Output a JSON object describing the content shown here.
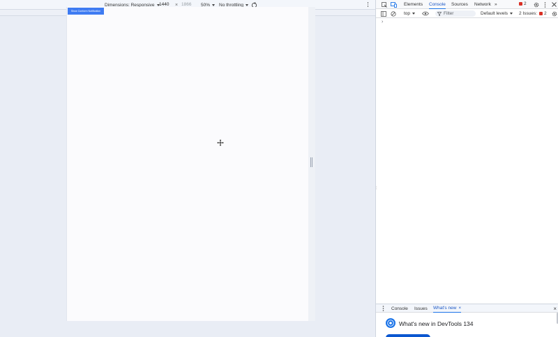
{
  "device_toolbar": {
    "dimensions_label": "Dimensions: Responsive",
    "width_value": "1440",
    "height_placeholder": "1866",
    "times_sign": "×",
    "zoom_label": "50%",
    "throttling_label": "No throttling"
  },
  "page": {
    "button_label": "Show Conform Notification"
  },
  "devtools": {
    "tabs": [
      "Elements",
      "Console",
      "Sources",
      "Network"
    ],
    "more_tabs": "»",
    "error_count": "2",
    "filter": {
      "context": "top",
      "placeholder": "Filter",
      "levels": "Default levels",
      "issues_label": "2 Issues:",
      "issues_count": "2"
    },
    "console_prompt": "›"
  },
  "drawer": {
    "tabs": [
      "Console",
      "Issues",
      "What's new"
    ],
    "close_tab": "×",
    "whats_new_title": "What's new in DevTools 134",
    "close": "×"
  },
  "colors": {
    "accent": "#1a73e8",
    "page_button": "#3e7bf2",
    "error": "#d93025"
  }
}
